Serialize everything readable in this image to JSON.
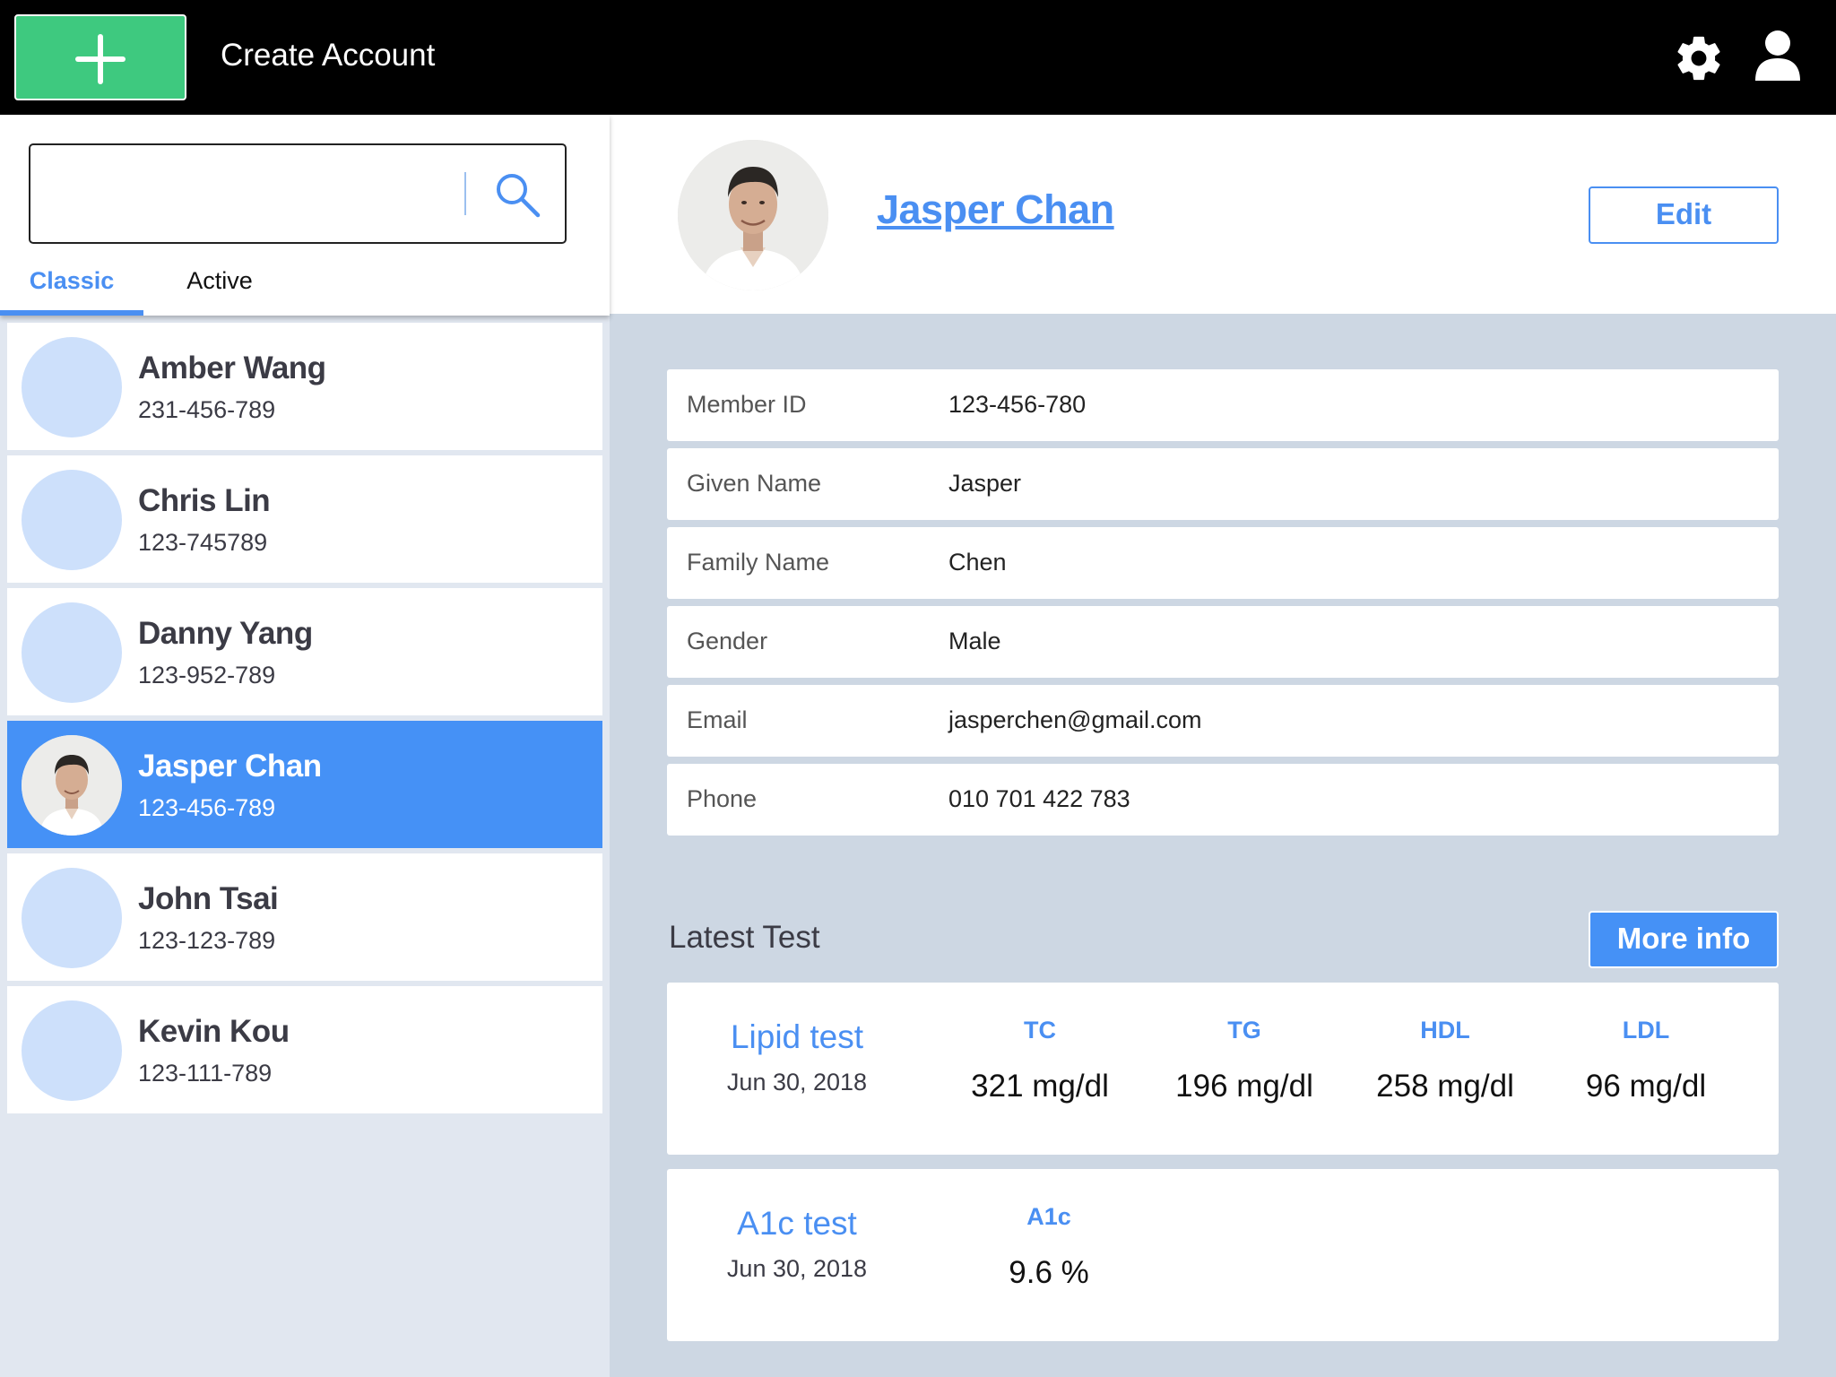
{
  "header": {
    "create_label": "Create Account",
    "add_icon": "plus-icon",
    "settings_icon": "gear-icon",
    "account_icon": "user-icon",
    "accent": "#3ec97f"
  },
  "sidebar": {
    "search": {
      "value": "",
      "placeholder": ""
    },
    "tabs": [
      {
        "label": "Classic",
        "selected": true
      },
      {
        "label": "Active",
        "selected": false
      }
    ],
    "contacts": [
      {
        "name": "Amber Wang",
        "phone": "231-456-789",
        "selected": false
      },
      {
        "name": "Chris Lin",
        "phone": "123-745789",
        "selected": false
      },
      {
        "name": "Danny Yang",
        "phone": "123-952-789",
        "selected": false
      },
      {
        "name": "Jasper Chan",
        "phone": "123-456-789",
        "selected": true
      },
      {
        "name": "John Tsai",
        "phone": "123-123-789",
        "selected": false
      },
      {
        "name": "Kevin Kou",
        "phone": "123-111-789",
        "selected": false
      }
    ]
  },
  "profile": {
    "name": "Jasper Chan",
    "edit_label": "Edit",
    "fields": [
      {
        "label": "Member ID",
        "value": "123-456-780"
      },
      {
        "label": "Given Name",
        "value": "Jasper"
      },
      {
        "label": "Family Name",
        "value": "Chen"
      },
      {
        "label": "Gender",
        "value": "Male"
      },
      {
        "label": "Email",
        "value": "jasperchen@gmail.com"
      },
      {
        "label": "Phone",
        "value": "010 701 422 783"
      }
    ]
  },
  "tests": {
    "title": "Latest Test",
    "more_label": "More info",
    "items": [
      {
        "name": "Lipid test",
        "date": "Jun 30, 2018",
        "metrics": [
          {
            "label": "TC",
            "value": "321 mg/dl"
          },
          {
            "label": "TG",
            "value": "196 mg/dl"
          },
          {
            "label": "HDL",
            "value": "258 mg/dl"
          },
          {
            "label": "LDL",
            "value": "96 mg/dl"
          }
        ]
      },
      {
        "name": "A1c test",
        "date": "Jun 30, 2018",
        "metrics": [
          {
            "label": "A1c",
            "value": "9.6 %"
          }
        ]
      }
    ]
  },
  "colors": {
    "primary": "#4591f6",
    "avatar_placeholder": "#cde0fb",
    "sidebar_bg": "#e1e7f0",
    "main_bg": "#cdd7e3"
  }
}
